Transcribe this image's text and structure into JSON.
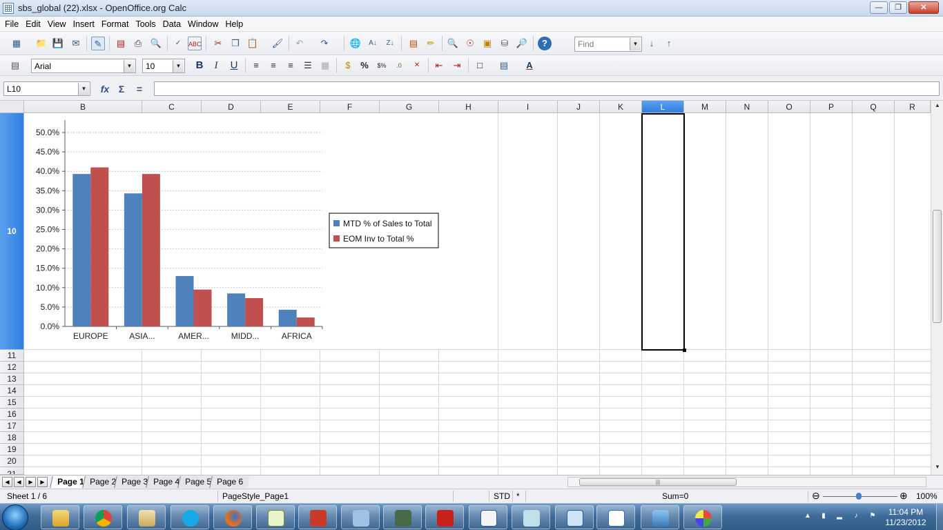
{
  "window": {
    "title": "sbs_global (22).xlsx - OpenOffice.org Calc"
  },
  "menu": [
    "File",
    "Edit",
    "View",
    "Insert",
    "Format",
    "Tools",
    "Data",
    "Window",
    "Help"
  ],
  "toolbar": {
    "find_placeholder": "Find",
    "font_name": "Arial",
    "font_size": "10"
  },
  "formula_bar": {
    "cell_ref": "L10",
    "content": ""
  },
  "columns": [
    "B",
    "C",
    "D",
    "E",
    "F",
    "G",
    "H",
    "I",
    "J",
    "K",
    "L",
    "M",
    "N",
    "O",
    "P",
    "Q",
    "R"
  ],
  "active_column": "L",
  "rows": [
    "10",
    "11",
    "12",
    "13",
    "14",
    "15",
    "16",
    "17",
    "18",
    "19",
    "20",
    "21"
  ],
  "active_row": "10",
  "chart_data": {
    "type": "bar",
    "categories": [
      "EUROPE",
      "ASIA...",
      "AMER...",
      "MIDD...",
      "AFRICA"
    ],
    "series": [
      {
        "name": "MTD % of Sales to Total",
        "color": "#4f81bd",
        "values": [
          39.3,
          34.3,
          13.0,
          8.5,
          4.3
        ]
      },
      {
        "name": "EOM Inv to Total %",
        "color": "#c0504d",
        "values": [
          41.0,
          39.3,
          9.5,
          7.3,
          2.3
        ]
      }
    ],
    "yticks": [
      "0.0%",
      "5.0%",
      "10.0%",
      "15.0%",
      "20.0%",
      "25.0%",
      "30.0%",
      "35.0%",
      "40.0%",
      "45.0%",
      "50.0%"
    ],
    "ylim": [
      0,
      50
    ],
    "grid": true,
    "legend_position": "right"
  },
  "sheet_tabs": [
    "Page 1",
    "Page 2",
    "Page 3",
    "Page 4",
    "Page 5",
    "Page 6"
  ],
  "active_tab": "Page 1",
  "status": {
    "sheet": "Sheet 1 / 6",
    "page_style": "PageStyle_Page1",
    "mode": "STD",
    "modified": "*",
    "sum": "Sum=0",
    "zoom": "100%"
  },
  "taskbar": {
    "apps": [
      "windows-explorer",
      "google-chrome",
      "outlook",
      "skype",
      "firefox",
      "notepad",
      "toolbox",
      "network",
      "terminal",
      "adobe-reader",
      "word",
      "notebook",
      "virtualbox",
      "openoffice-calc",
      "photos",
      "paint"
    ],
    "time": "11:04 PM",
    "date": "11/23/2012"
  }
}
